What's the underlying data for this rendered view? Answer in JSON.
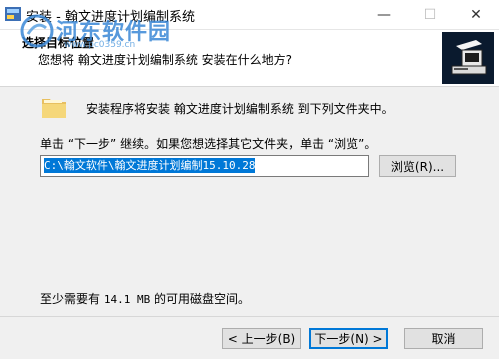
{
  "window": {
    "title": "安装 - 翰文进度计划编制系统",
    "minimize_glyph": "—",
    "maximize_glyph": "☐",
    "close_glyph": "✕"
  },
  "header": {
    "title": "选择目标位置",
    "subtitle": "您想将 翰文进度计划编制系统 安装在什么地方?"
  },
  "watermark": {
    "text": "河东软件园",
    "url": "www.pc0359.cn"
  },
  "body": {
    "intro": "安装程序将安装 翰文进度计划编制系统 到下列文件夹中。",
    "instruction": "单击 “下一步” 继续。如果您想选择其它文件夹，单击 “浏览”。",
    "path_value": "C:\\翰文软件\\翰文进度计划编制15.10.28",
    "browse_label": "浏览(R)...",
    "space_prefix": "至少需要有 ",
    "space_value": "14.1 MB",
    "space_suffix": " 的可用磁盘空间。"
  },
  "footer": {
    "back_label": "< 上一步(B)",
    "next_label": "下一步(N) >",
    "cancel_label": "取消"
  },
  "colors": {
    "selection": "#0078d7",
    "header_icon_bg": "#0a1a2e",
    "watermark": "#3a88d6"
  },
  "icons": {
    "app": "installer-icon",
    "folder": "folder-icon",
    "header": "computer-install-icon"
  }
}
